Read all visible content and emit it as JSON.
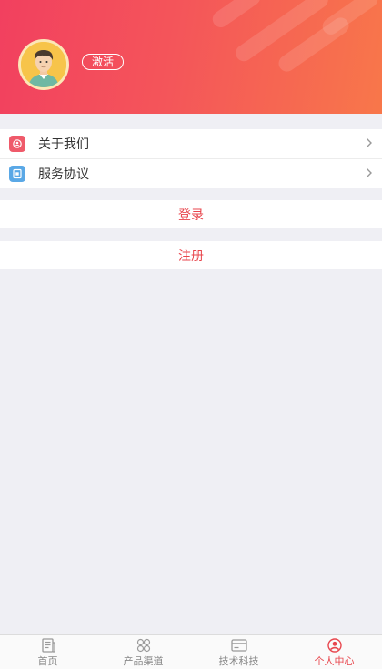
{
  "profile": {
    "activate_label": "激活"
  },
  "menu": {
    "items": [
      {
        "label": "关于我们",
        "icon": "about-us-icon"
      },
      {
        "label": "服务协议",
        "icon": "service-agreement-icon"
      }
    ]
  },
  "actions": {
    "login_label": "登录",
    "register_label": "注册"
  },
  "tabbar": {
    "tabs": [
      {
        "label": "首页",
        "icon": "home-news-icon",
        "active": false
      },
      {
        "label": "产品渠道",
        "icon": "grid-icon",
        "active": false
      },
      {
        "label": "技术科技",
        "icon": "card-icon",
        "active": false
      },
      {
        "label": "个人中心",
        "icon": "user-circle-icon",
        "active": true
      }
    ]
  },
  "colors": {
    "accent": "#e8464d",
    "header_start": "#f2405f",
    "header_end": "#f8774a"
  }
}
